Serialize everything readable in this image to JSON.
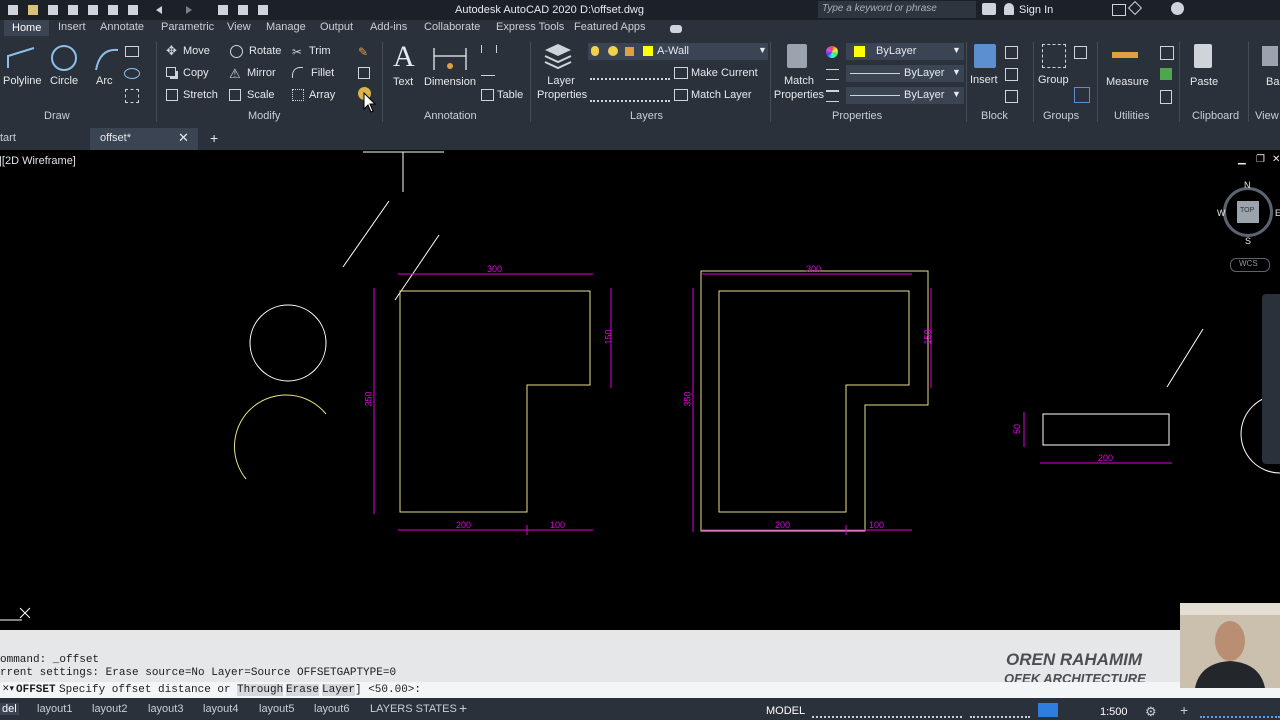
{
  "app": {
    "title": "Autodesk AutoCAD 2020",
    "file": "D:\\offset.dwg",
    "search_placeholder": "Type a keyword or phrase",
    "signin": "Sign In"
  },
  "ribbon_tabs": [
    "Home",
    "Insert",
    "Annotate",
    "Parametric",
    "View",
    "Manage",
    "Output",
    "Add-ins",
    "Collaborate",
    "Express Tools",
    "Featured Apps"
  ],
  "draw": {
    "polyline": "Polyline",
    "circle": "Circle",
    "arc": "Arc",
    "title": "Draw"
  },
  "modify": {
    "move": "Move",
    "rotate": "Rotate",
    "trim": "Trim",
    "copy": "Copy",
    "mirror": "Mirror",
    "fillet": "Fillet",
    "stretch": "Stretch",
    "scale": "Scale",
    "array": "Array",
    "title": "Modify"
  },
  "annotation": {
    "text": "Text",
    "dimension": "Dimension",
    "table": "Table",
    "title": "Annotation"
  },
  "layers": {
    "layer_properties": "Layer Properties",
    "current_layer": "A-Wall",
    "make_current": "Make Current",
    "match_layer": "Match Layer",
    "title": "Layers"
  },
  "properties": {
    "match_properties": "Match Properties",
    "color": "ByLayer",
    "linetype": "ByLayer",
    "lineweight": "ByLayer",
    "title": "Properties"
  },
  "block": {
    "insert": "Insert",
    "title": "Block"
  },
  "groups": {
    "group": "Group",
    "title": "Groups"
  },
  "utilities": {
    "measure": "Measure",
    "title": "Utilities"
  },
  "clipboard": {
    "paste": "Paste",
    "title": "Clipboard"
  },
  "view_panel": {
    "base": "Bas",
    "title": "View"
  },
  "doc_tabs": {
    "start": "tart",
    "current": "offset*"
  },
  "viewport_label": "]|[2D Wireframe]",
  "viewcube": {
    "n": "N",
    "s": "S",
    "e": "E",
    "w": "W",
    "top": "TOP",
    "wcs": "WCS"
  },
  "dims": {
    "shape1_top": "300",
    "shape1_right": "150",
    "shape1_left": "350",
    "shape1_bottom_a": "200",
    "shape1_bottom_b": "100",
    "shape2_top": "300",
    "shape2_right": "150",
    "shape2_left": "350",
    "shape2_bottom_a": "200",
    "shape2_bottom_b": "100",
    "rect_height": "50",
    "rect_width": "200"
  },
  "command": {
    "history1": "ommand: _offset",
    "history2": "rrent settings: Erase source=No  Layer=Source  OFFSETGAPTYPE=0",
    "prompt_cmd": "OFFSET",
    "prompt_text": "Specify offset distance or [",
    "opt_through": "Through",
    "opt_erase": "Erase",
    "opt_layer": "Layer",
    "prompt_end": "] <50.00>:"
  },
  "watermark": {
    "name": "OREN RAHAMIM",
    "company": "OFEK ARCHITECTURE"
  },
  "layout_tabs": [
    "del",
    "layout1",
    "layout2",
    "layout3",
    "layout4",
    "layout5",
    "layout6",
    "LAYERS STATES"
  ],
  "status": {
    "model": "MODEL",
    "scale": "1:500"
  },
  "colors": {
    "ribbon": "#2b313a",
    "yellow": "#e6e08a",
    "magenta": "#e000e0",
    "white": "#ffffff",
    "canvas": "#000000"
  }
}
